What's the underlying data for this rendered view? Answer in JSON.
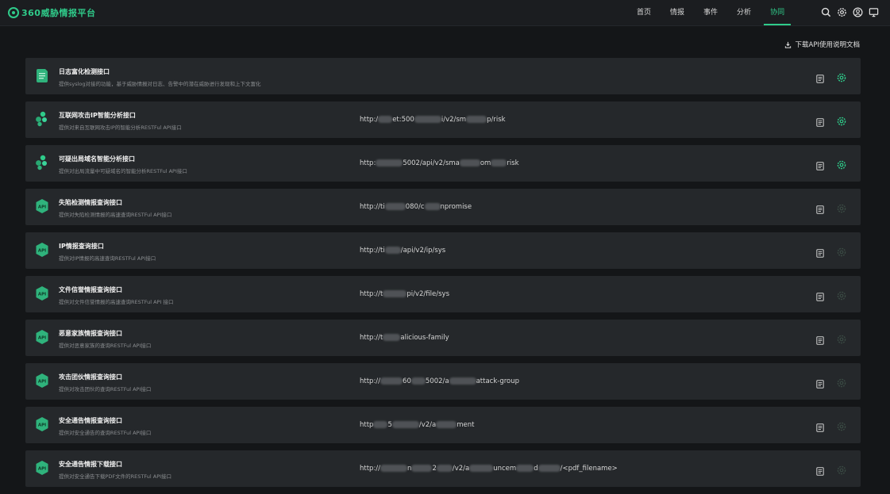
{
  "app": {
    "logo_text": "360威胁情报平台"
  },
  "nav": [
    {
      "label": "首页",
      "active": false
    },
    {
      "label": "情报",
      "active": false
    },
    {
      "label": "事件",
      "active": false
    },
    {
      "label": "分析",
      "active": false
    },
    {
      "label": "协同",
      "active": true
    }
  ],
  "toolbar": {
    "download_label": "下载API使用说明文档"
  },
  "colors": {
    "accent": "#2fcb8a",
    "card_bg": "#25282b",
    "page_bg": "#141618"
  },
  "apis": [
    {
      "title": "日志富化检测接口",
      "desc": "提供syslog对接的功能，基于威胁情报对日志、告警中的潜在威胁进行发现和上下文富化",
      "url_parts": [],
      "icon": "log-icon",
      "settings_active": true
    },
    {
      "title": "互联网攻击IP智能分析接口",
      "desc": "提供对来自互联网攻击IP的智能分析RESTFul API接口",
      "url_parts": [
        "http:/",
        "et:500",
        "i/v2/sm",
        "p/risk"
      ],
      "icon": "cluster-icon",
      "settings_active": true
    },
    {
      "title": "可疑出局域名智能分析接口",
      "desc": "提供对出局流量中可疑域名的智能分析RESTFul API接口",
      "url_parts": [
        "http:",
        "5002/api/v2/sma",
        "om",
        "risk"
      ],
      "icon": "cluster-icon",
      "settings_active": true
    },
    {
      "title": "失陷检测情报查询接口",
      "desc": "提供对失陷检测情报的高速查询RESTFul API接口",
      "url_parts": [
        "http://ti",
        "080/c",
        "npromise"
      ],
      "icon": "api-icon",
      "settings_active": false
    },
    {
      "title": "IP情报查询接口",
      "desc": "提供对IP情报的高速查询RESTFul API接口",
      "url_parts": [
        "http://ti",
        "/api/v2/ip/sys"
      ],
      "icon": "api-icon",
      "settings_active": false
    },
    {
      "title": "文件信誉情报查询接口",
      "desc": "提供对文件信誉情报的高速查询RESTFul API 接口",
      "url_parts": [
        "http://t",
        "pi/v2/file/sys"
      ],
      "icon": "api-icon",
      "settings_active": false
    },
    {
      "title": "恶意家族情报查询接口",
      "desc": "提供对恶意家族的查询RESTFul API接口",
      "url_parts": [
        "http://t",
        "alicious-family"
      ],
      "icon": "api-icon",
      "settings_active": false
    },
    {
      "title": "攻击团伙情报查询接口",
      "desc": "提供对攻击团伙的查询RESTFul API接口",
      "url_parts": [
        "http://",
        "60",
        "5002/a",
        "attack-group"
      ],
      "icon": "api-icon",
      "settings_active": false
    },
    {
      "title": "安全通告情报查询接口",
      "desc": "提供对安全通告的查询RESTFul API接口",
      "url_parts": [
        "http",
        "5",
        "/v2/a",
        "ment"
      ],
      "icon": "api-icon",
      "settings_active": false
    },
    {
      "title": "安全通告情报下载接口",
      "desc": "提供对安全通告下载PDF文件的RESTFul API接口",
      "url_parts": [
        "http://",
        "n",
        "2",
        "/v2/a",
        "uncem",
        "d",
        "/<pdf_filename>"
      ],
      "icon": "api-icon",
      "settings_active": false
    }
  ]
}
